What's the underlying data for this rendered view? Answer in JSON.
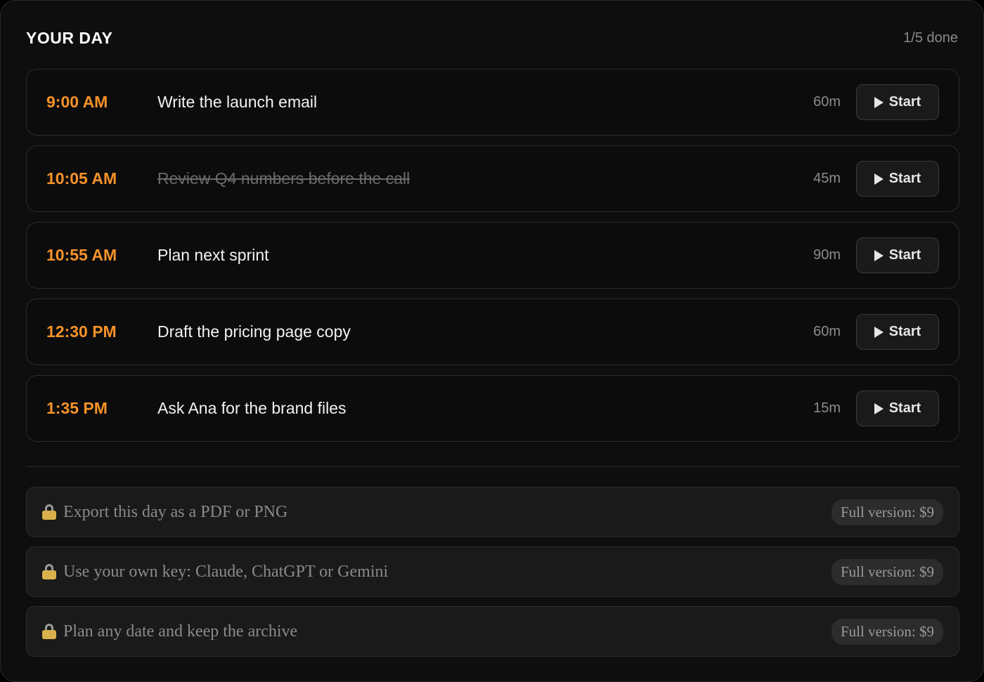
{
  "header": {
    "title": "YOUR DAY",
    "progress": "1/5 done"
  },
  "tasks": [
    {
      "time": "9:00 AM",
      "name": "Write the launch email",
      "duration": "60m",
      "done": false,
      "action": "Start"
    },
    {
      "time": "10:05 AM",
      "name": "Review Q4 numbers before the call",
      "duration": "45m",
      "done": true,
      "action": "Start"
    },
    {
      "time": "10:55 AM",
      "name": "Plan next sprint",
      "duration": "90m",
      "done": false,
      "action": "Start"
    },
    {
      "time": "12:30 PM",
      "name": "Draft the pricing page copy",
      "duration": "60m",
      "done": false,
      "action": "Start"
    },
    {
      "time": "1:35 PM",
      "name": "Ask Ana for the brand files",
      "duration": "15m",
      "done": false,
      "action": "Start"
    }
  ],
  "locked_features": [
    {
      "icon": "lock-icon",
      "label": "Export this day as a PDF or PNG",
      "price": "Full version: $9"
    },
    {
      "icon": "lock-icon",
      "label": "Use your own key: Claude, ChatGPT or Gemini",
      "price": "Full version: $9"
    },
    {
      "icon": "lock-icon",
      "label": "Plan any date and keep the archive",
      "price": "Full version: $9"
    }
  ],
  "colors": {
    "accent": "#f5922a",
    "background": "#0e0e0e",
    "lock": "#d9b04c"
  }
}
